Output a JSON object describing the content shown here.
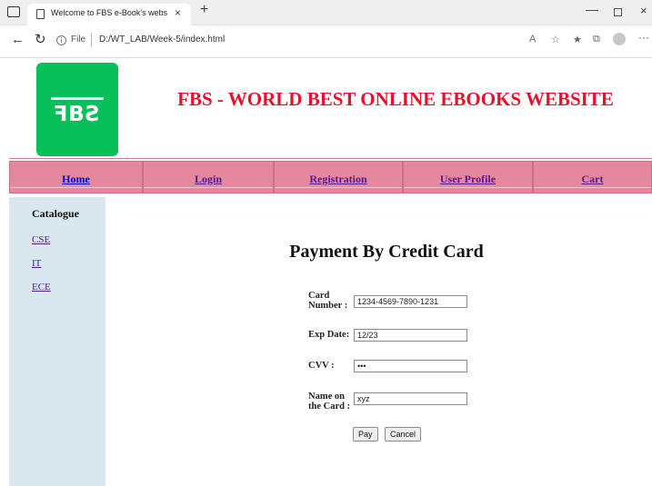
{
  "browser": {
    "tab_title": "Welcome to FBS e-Book's website",
    "tab_close": "×",
    "new_tab": "+",
    "file_label": "File",
    "url": "D:/WT_LAB/Week-5/index.html",
    "nav_back": "←",
    "nav_refresh": "↻",
    "window_min": "—",
    "window_close": "×",
    "more": "···"
  },
  "header": {
    "logo_text": "ꟻBƧ",
    "site_title": "FBS - WORLD BEST ONLINE EBOOKS WEBSITE"
  },
  "nav": {
    "items": [
      {
        "label": "Home"
      },
      {
        "label": "Login"
      },
      {
        "label": "Registration"
      },
      {
        "label": "User Profile"
      },
      {
        "label": "Cart"
      }
    ]
  },
  "sidebar": {
    "title": "Catalogue",
    "links": [
      {
        "label": "CSE"
      },
      {
        "label": "IT"
      },
      {
        "label": "ECE"
      }
    ]
  },
  "form": {
    "title": "Payment By Credit Card",
    "card_number_label_1": "Card",
    "card_number_label_2": "Number :",
    "card_number_value": "1234-4569-7890-1231",
    "exp_date_label": "Exp Date:",
    "exp_date_value": "12/23",
    "cvv_label": "CVV :",
    "cvv_value": "•••",
    "name_label_1": "Name on",
    "name_label_2": "the Card :",
    "name_value": "xyz",
    "pay_label": "Pay",
    "cancel_label": "Cancel"
  },
  "colors": {
    "nav_bg": "#e5879f",
    "title_red": "#e8102a",
    "logo_green": "#07c05a",
    "sidebar_bg": "#d8e8ee"
  }
}
